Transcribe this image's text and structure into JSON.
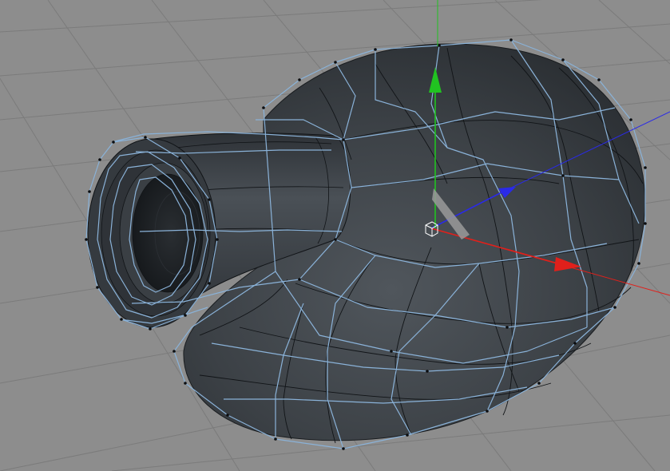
{
  "viewport": {
    "background_color": "#8d8d8d",
    "grid_color": "#7b7b7b",
    "object": {
      "name": "",
      "surface_color": "#3d4247",
      "cage_color": "#8ab2d8",
      "edge_color": "#111417",
      "subdivision": true
    },
    "gizmo": {
      "x_axis_color": "#e0201b",
      "y_axis_color": "#21c321",
      "z_axis_color": "#2a2ae8",
      "pivot_icon": "cube-pivot-icon"
    }
  }
}
